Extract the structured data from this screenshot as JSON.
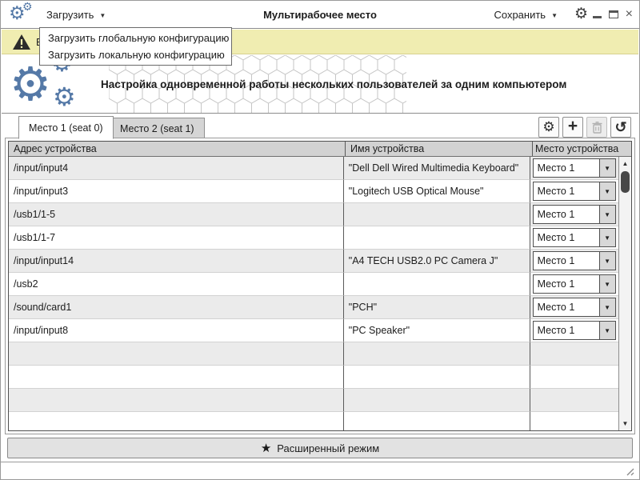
{
  "window": {
    "title": "Мультирабочее место"
  },
  "toolbar": {
    "load_label": "Загрузить",
    "save_label": "Сохранить"
  },
  "load_menu": {
    "items": [
      "Загрузить глобальную конфигурацию",
      "Загрузить локальную конфигурацию"
    ]
  },
  "warning_bar": {
    "visible_text": "В"
  },
  "banner": {
    "text": "Настройка одновременной работы нескольких пользователей за одним компьютером"
  },
  "tabs": [
    {
      "label": "Место 1 (seat 0)",
      "active": true
    },
    {
      "label": "Место 2 (seat 1)",
      "active": false
    }
  ],
  "table": {
    "columns": [
      "Адрес устройства",
      "Имя устройства",
      "Место устройства"
    ],
    "rows": [
      {
        "address": "/input/input4",
        "name": "\"Dell Dell Wired Multimedia Keyboard\"",
        "seat": "Место 1"
      },
      {
        "address": "/input/input3",
        "name": "\"Logitech USB Optical Mouse\"",
        "seat": "Место 1"
      },
      {
        "address": "/usb1/1-5",
        "name": "",
        "seat": "Место 1"
      },
      {
        "address": "/usb1/1-7",
        "name": "",
        "seat": "Место 1"
      },
      {
        "address": "/input/input14",
        "name": "\"A4 TECH USB2.0 PC Camera J\"",
        "seat": "Место 1"
      },
      {
        "address": "/usb2",
        "name": "",
        "seat": "Место 1"
      },
      {
        "address": "/sound/card1",
        "name": "\"PCH\"",
        "seat": "Место 1"
      },
      {
        "address": "/input/input8",
        "name": "\"PC Speaker\"",
        "seat": "Место 1"
      }
    ]
  },
  "footer": {
    "extended_mode_label": "Расширенный режим"
  },
  "icons": {
    "gear": "⚙",
    "dropdown_arrow": "▼",
    "plus": "+",
    "undo": "↺",
    "star": "★",
    "minimize_glyph": "",
    "close_glyph": "×",
    "scroll_up": "▲",
    "scroll_down": "▼"
  },
  "colors": {
    "accent_blue": "#5579A7",
    "warning_bg": "#F0EDB1",
    "header_gray": "#D2D2D2",
    "row_alt": "#EBEBEB"
  }
}
